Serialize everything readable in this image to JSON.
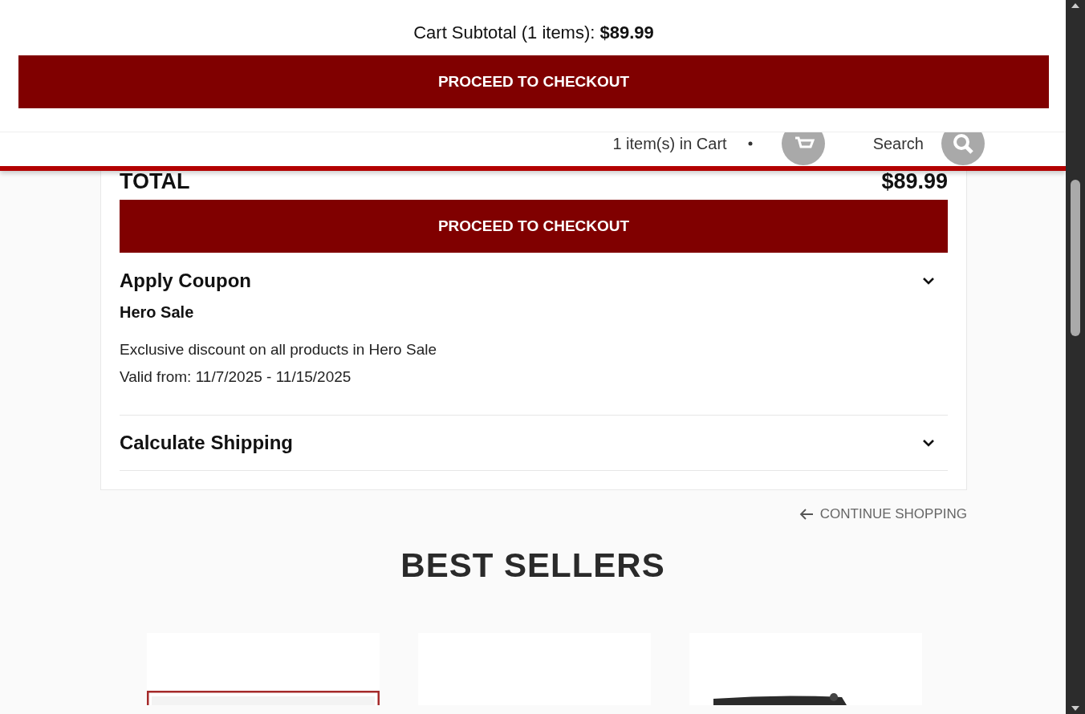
{
  "sticky_bar": {
    "subtotal_label": "Cart Subtotal (1 items):",
    "subtotal_value": "$89.99",
    "checkout_button": "PROCEED TO CHECKOUT"
  },
  "header": {
    "cart_label": "1 item(s) in Cart",
    "search_label": "Search"
  },
  "summary": {
    "total_label": "TOTAL",
    "total_value": "$89.99",
    "checkout_button": "PROCEED TO CHECKOUT",
    "sections": [
      {
        "title": "Apply Coupon",
        "coupon": {
          "name": "Hero Sale",
          "description": "Exclusive discount on all products in Hero Sale",
          "validity": "Valid from: 11/7/2025 - 11/15/2025"
        }
      },
      {
        "title": "Calculate Shipping"
      }
    ]
  },
  "continue_link": "CONTINUE SHOPPING",
  "best_sellers": {
    "title": "BEST SELLERS",
    "products": [
      {
        "kind": "picture"
      },
      {
        "kind": "blank"
      },
      {
        "kind": "picture"
      }
    ]
  }
}
